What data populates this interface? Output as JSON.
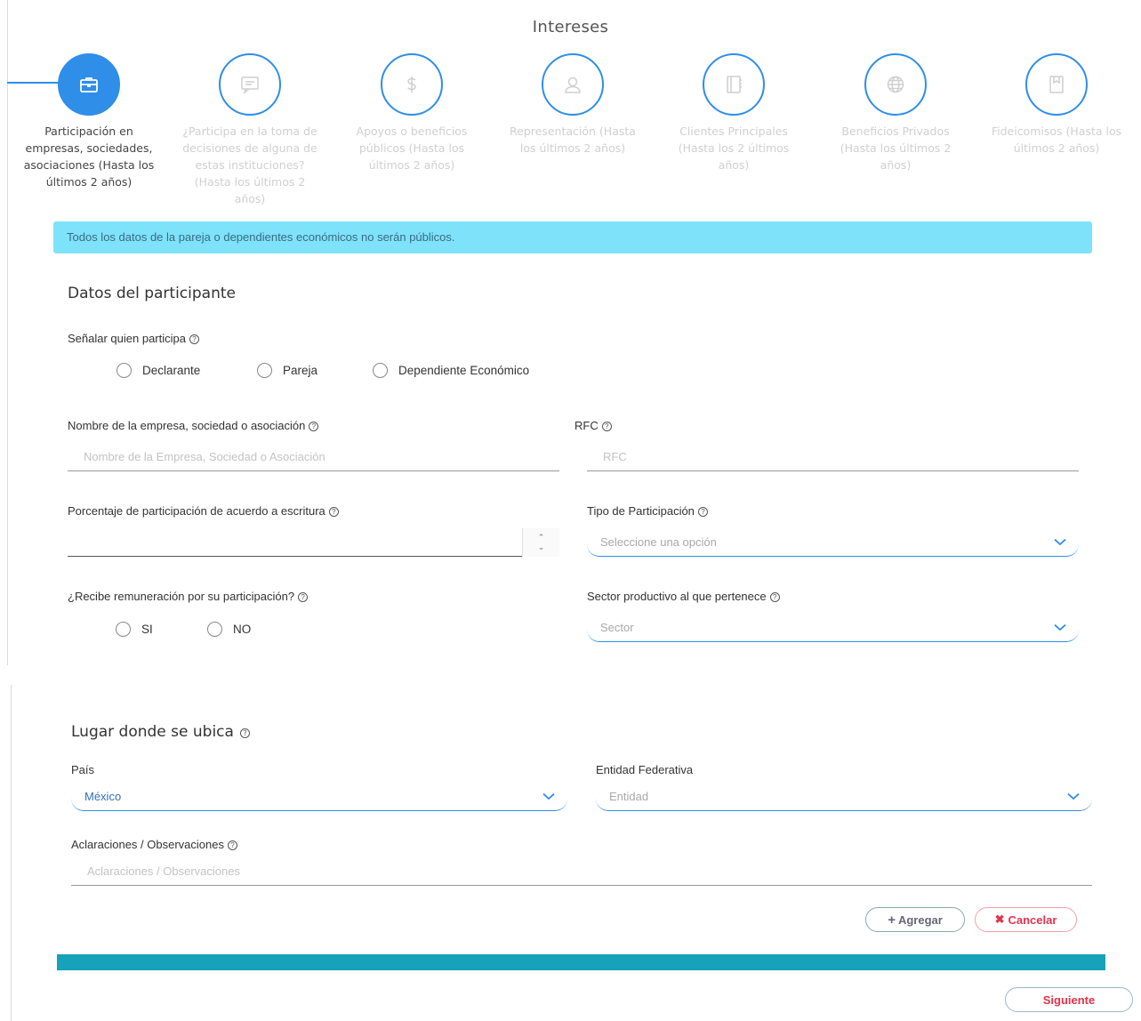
{
  "header": {
    "title": "Intereses"
  },
  "steps": [
    {
      "label": "Participación en empresas, sociedades, asociaciones (Hasta los últimos 2 años)",
      "icon": "briefcase-icon",
      "active": true
    },
    {
      "label": "¿Participa en la toma de decisiones de alguna de estas instituciones? (Hasta los últimos 2 años)",
      "icon": "chat-icon",
      "active": false
    },
    {
      "label": "Apoyos o beneficios públicos (Hasta los últimos 2 años)",
      "icon": "dollar-icon",
      "active": false
    },
    {
      "label": "Representación (Hasta los últimos 2 años)",
      "icon": "user-icon",
      "active": false
    },
    {
      "label": "Clientes Principales (Hasta los 2 últimos años)",
      "icon": "notebook-icon",
      "active": false
    },
    {
      "label": "Beneficios Privados (Hasta los últimos 2 años)",
      "icon": "globe-icon",
      "active": false
    },
    {
      "label": "Fideicomisos (Hasta los últimos 2 años)",
      "icon": "bookmark-icon",
      "active": false
    }
  ],
  "alert": {
    "text": "Todos los datos de la pareja o dependientes económicos no serán públicos."
  },
  "participant": {
    "title": "Datos del participante",
    "who_label": "Señalar quien participa",
    "who_options": [
      "Declarante",
      "Pareja",
      "Dependiente Económico"
    ],
    "company_label": "Nombre de la empresa, sociedad o asociación",
    "company_placeholder": "Nombre de la Empresa, Sociedad o Asociación",
    "rfc_label": "RFC",
    "rfc_placeholder": "RFC",
    "percent_label": "Porcentaje de participación de acuerdo a escritura",
    "type_label": "Tipo de Participación",
    "type_value": "Seleccione una opción",
    "remuneration_label": "¿Recibe remuneración por su participación?",
    "remuneration_options": [
      "SI",
      "NO"
    ],
    "sector_label": "Sector productivo al que pertenece",
    "sector_value": "Sector"
  },
  "location": {
    "title": "Lugar donde se ubica",
    "country_label": "País",
    "country_value": "México",
    "state_label": "Entidad Federativa",
    "state_value": "Entidad",
    "notes_label": "Aclaraciones / Observaciones",
    "notes_placeholder": "Aclaraciones / Observaciones"
  },
  "actions": {
    "add_label": "Agregar",
    "cancel_label": "Cancelar",
    "next_label": "Siguiente"
  },
  "colors": {
    "primary": "#2f8ee8",
    "alert_bg": "#7ee2fb",
    "teal": "#16a2b8",
    "danger": "#e4324c"
  }
}
